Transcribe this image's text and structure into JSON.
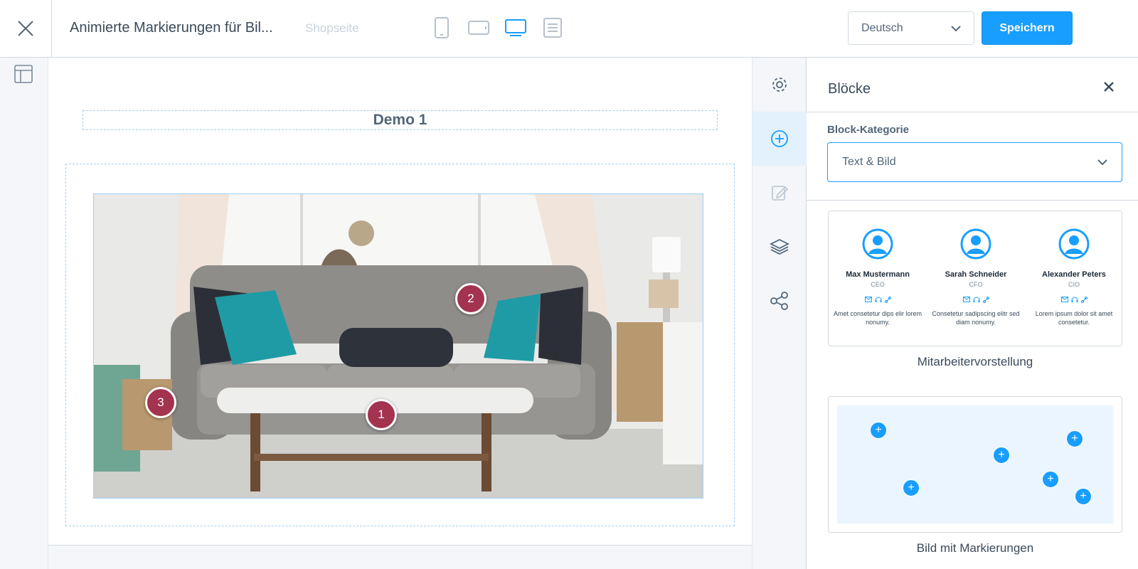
{
  "header": {
    "title": "Animierte Markierungen für Bil...",
    "page_type": "Shopseite",
    "language": "Deutsch",
    "save_label": "Speichern"
  },
  "devices": [
    "phone-icon",
    "tablet-icon",
    "desktop-icon",
    "list-icon"
  ],
  "canvas": {
    "heading": "Demo 1",
    "hotspots": [
      "1",
      "2",
      "3"
    ]
  },
  "tools": [
    "gear-icon",
    "plus-circle-icon",
    "edit-icon",
    "layers-icon",
    "share-icon"
  ],
  "sidebar": {
    "title": "Blöcke",
    "category_label": "Block-Kategorie",
    "category_value": "Text & Bild",
    "blocks": [
      {
        "name": "Mitarbeitervorstellung",
        "members": [
          {
            "name": "Max Mustermann",
            "role": "CEO",
            "desc": "Amet consetetur dips elir lorem nonumy."
          },
          {
            "name": "Sarah Schneider",
            "role": "CFO",
            "desc": "Consetetur sadipscing elitr sed diam nonumy."
          },
          {
            "name": "Alexander Peters",
            "role": "CIO",
            "desc": "Lorem ipsum dolor sit amet consetetur."
          }
        ]
      },
      {
        "name": "Bild mit Markierungen"
      }
    ]
  },
  "colors": {
    "accent": "#189eff",
    "hotspot": "#a3334f",
    "text": "#52667a"
  }
}
